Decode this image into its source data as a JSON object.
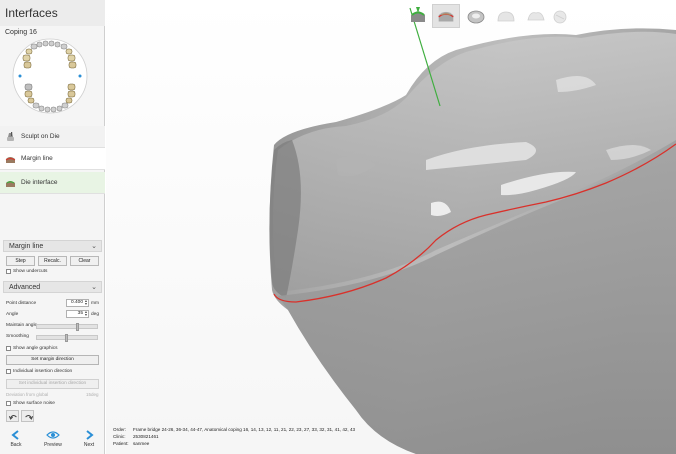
{
  "app": {
    "title": "Interfaces"
  },
  "case": {
    "name": "Coping 16"
  },
  "steps": [
    {
      "label": "Sculpt on Die"
    },
    {
      "label": "Margin line"
    },
    {
      "label": "Die interface"
    }
  ],
  "margin_section": {
    "title": "Margin line",
    "chevron": "⌄",
    "buttons": {
      "step": "Step",
      "recalc": "Recalc.",
      "clear": "Clear"
    },
    "show_undercuts": "Show undercuts"
  },
  "advanced_section": {
    "title": "Advanced",
    "chevron": "⌄",
    "point_distance": {
      "label": "Point distance",
      "value": "0.400",
      "unit": "mm"
    },
    "angle": {
      "label": "Angle",
      "value": "35",
      "unit": "deg"
    },
    "maintain_angle": {
      "label": "Maintain angle",
      "level": 0.7
    },
    "smoothing": {
      "label": "Smoothing",
      "level": 0.5
    },
    "show_angle_graphics": "Show angle graphics",
    "set_margin_direction": "Set margin direction",
    "individual_insertion_direction": "Individual insertion direction",
    "set_individual_insertion_direction": "Set individual insertion direction",
    "deviation_label": "Deviation from global",
    "deviation_value": "15deg",
    "show_surface_noise": "Show surface noise"
  },
  "nav": {
    "back": "Back",
    "preview": "Preview",
    "next": "Next"
  },
  "info": {
    "order_key": "Order:",
    "order_value": "Frame bridge 24-26, 36-34, 44-47, Anatomical coping 16, 14, 13, 12, 11, 21, 22, 23, 27, 33, 32, 31, 41, 42, 43",
    "clinic_key": "Clinic:",
    "clinic_value": "2530821461",
    "patient_key": "Patient:",
    "patient_value": "sanmee"
  },
  "colors": {
    "accent": "#2a8fd6",
    "margin_line": "#d9312b",
    "insertion_axis": "#3fae3f"
  },
  "icons": {
    "steps": [
      "sculpt-die-icon",
      "margin-line-icon",
      "die-interface-icon"
    ],
    "toolbar": [
      "die-green-view-icon",
      "die-red-view-icon",
      "crown-view-icon",
      "ghost-view-1-icon",
      "ghost-view-2-icon",
      "ghost-view-3-icon"
    ]
  }
}
